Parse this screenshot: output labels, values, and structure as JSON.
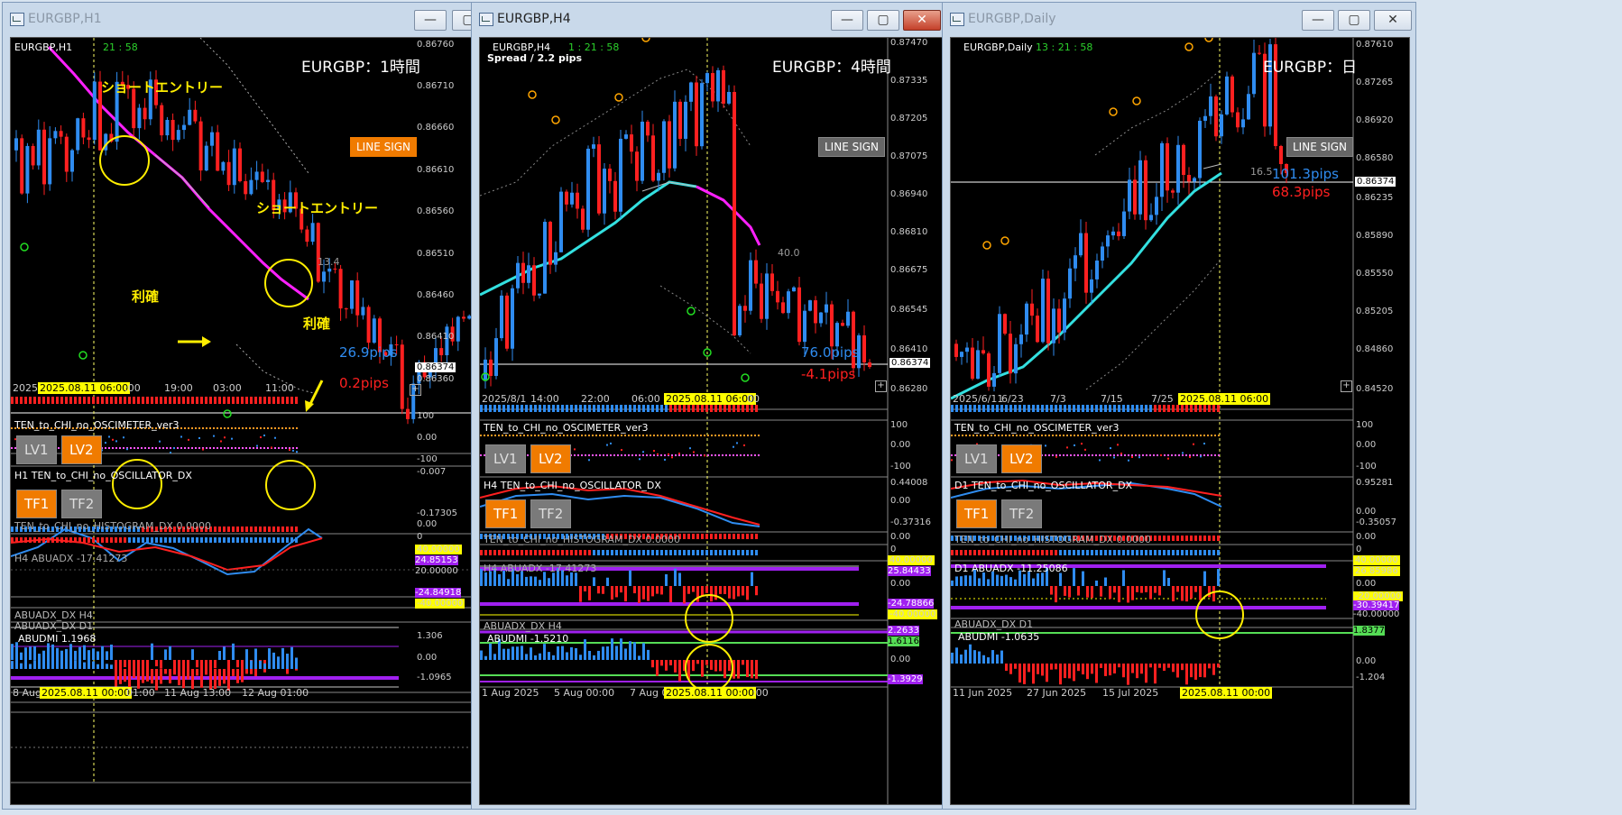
{
  "windows": [
    {
      "id": "h1",
      "title": "EURGBP,H1",
      "symbol": "EURGBP,H1",
      "timer": "21 : 58",
      "chart_title": "EURGBP：1時間",
      "spread": "",
      "line_sign": "LINE SIGN",
      "prices": [
        "0.86760",
        "0.86710",
        "0.86660",
        "0.86610",
        "0.86560",
        "0.86510",
        "0.86460",
        "0.86410",
        "0.86360"
      ],
      "current_price": "0.86374",
      "pips_up": "26.9pips",
      "pips_down": "0.2pips",
      "level_value": "13.4",
      "time_labels": [
        "2025/",
        "2025.08.11 06:00",
        ":00",
        "19:00",
        "03:00",
        "11:00"
      ],
      "bottom_time_labels": [
        "8 Aug",
        "2025.08.11 00:00",
        "01:00",
        "11 Aug 13:00",
        "12 Aug 01:00"
      ],
      "annotations": [
        "ショートエントリー",
        "ショートエントリー",
        "利確",
        "利確"
      ],
      "osc_title": "TEN_to_CHI_no_OSCIMETER_ver3",
      "osc_levels": [
        "100",
        "0.00",
        "-100"
      ],
      "lv1": "LV1",
      "lv2": "LV2",
      "dx_title": "H1 TEN_to_CHI_no_OSCILLATOR_DX",
      "dx_levels": [
        "-0.007",
        "-0.17305"
      ],
      "tf1": "TF1",
      "tf2": "TF2",
      "hist_title": "TEN_to_CHI_no_HISTOGRAM_DX 0.0000",
      "hist_levels": [
        "0.00",
        "0"
      ],
      "abuadx_title": "H4 ABUADX -17.41273",
      "abuadx_levels": [
        "40.00000",
        "24.85153",
        "20.00000",
        "-24.84918",
        "-40.00000"
      ],
      "abuadx_h4": "ABUADX_DX H4",
      "abuadx_d1": "ABUADX_DX D1",
      "abudmi_title": "ABUDMI  1.1968",
      "abudmi_levels": [
        "1.306",
        "0.00",
        "-1.0965"
      ],
      "sub_mark": "H1"
    },
    {
      "id": "h4",
      "title": "EURGBP,H4",
      "symbol": "EURGBP,H4",
      "timer": "1 : 21 : 58",
      "chart_title": "EURGBP：4時間",
      "spread": "Spread / 2.2 pips",
      "line_sign": "LINE SIGN",
      "prices": [
        "0.87470",
        "0.87335",
        "0.87205",
        "0.87075",
        "0.86940",
        "0.86810",
        "0.86675",
        "0.86545",
        "0.86410",
        "0.86280"
      ],
      "current_price": "0.86374",
      "pips_up": "76.0pips",
      "pips_down": "-4.1pips",
      "level_value": "40.0",
      "time_labels": [
        "2025/8/1",
        "14:00",
        "22:00",
        "06:00",
        "2025.08.11 06:00",
        "00"
      ],
      "bottom_time_labels": [
        "1 Aug 2025",
        "5 Aug 00:00",
        "7 Aug 0",
        "2025.08.11 00:00",
        ":00"
      ],
      "annotations": [],
      "osc_title": "TEN_to_CHI_no_OSCIMETER_ver3",
      "osc_levels": [
        "100",
        "0.00",
        "-100"
      ],
      "lv1": "LV1",
      "lv2": "LV2",
      "dx_title": "H4 TEN_to_CHI_no_OSCILLATOR_DX",
      "dx_levels": [
        "0.44008",
        "0.00",
        "-0.37316"
      ],
      "tf1": "TF1",
      "tf2": "TF2",
      "hist_title": "TEN_to_CHI_no_HISTOGRAM_DX 0.0000",
      "hist_levels": [
        "0.00",
        "0"
      ],
      "abuadx_title": "H4 ABUADX -17.41273",
      "abuadx_levels": [
        "40.00000",
        "25.84433",
        "0.00",
        "-24.78866",
        "-40.00000"
      ],
      "abuadx_h4": "ABUADX_DX H4",
      "abuadx_d1": "",
      "abudmi_title": "ABUDMI  -1.5210",
      "abudmi_levels": [
        "2.2633",
        "1.6116",
        "0.00",
        "-1.3929"
      ],
      "sub_mark": "H4"
    },
    {
      "id": "d1",
      "title": "EURGBP,Daily",
      "symbol": "EURGBP,Daily",
      "timer": "13 : 21 : 58",
      "chart_title": "EURGBP：日",
      "spread": "",
      "line_sign": "LINE SIGN",
      "prices": [
        "0.87610",
        "0.87265",
        "0.86920",
        "0.86580",
        "0.86235",
        "0.85890",
        "0.85550",
        "0.85205",
        "0.84860",
        "0.84520"
      ],
      "current_price": "0.86374",
      "pips_up": "101.3pips",
      "pips_down": "68.3pips",
      "level_value": "16.5",
      "time_labels": [
        "2025/6/11",
        "6/23",
        "7/3",
        "7/15",
        "7/25",
        "2025.08.11 06:00"
      ],
      "bottom_time_labels": [
        "11 Jun 2025",
        "27 Jun 2025",
        "15 Jul 2025",
        "2025.08.11 00:00"
      ],
      "annotations": [],
      "osc_title": "TEN_to_CHI_no_OSCIMETER_ver3",
      "osc_levels": [
        "100",
        "0.00",
        "-100"
      ],
      "lv1": "LV1",
      "lv2": "LV2",
      "dx_title": "D1 TEN_to_CHI_no_OSCILLATOR_DX",
      "dx_levels": [
        "0.95281",
        "0.00",
        "-0.35057"
      ],
      "tf1": "TF1",
      "tf2": "TF2",
      "hist_title": "TEN_to_CHI_no_HISTOGRAM_DX 0.0000",
      "hist_levels": [
        "0.00",
        "0"
      ],
      "abuadx_title": "D1 ABUADX -11.25086",
      "abuadx_levels": [
        "40.00000",
        "26.85986",
        "0.00",
        "-20.00000",
        "-30.39417",
        "-40.00000"
      ],
      "abuadx_h4": "ABUADX_DX D1",
      "abuadx_d1": "",
      "abudmi_title": "ABUDMI  -1.0635",
      "abudmi_levels": [
        "1.8377",
        "0.00",
        "-1.204"
      ],
      "sub_mark": "D1"
    }
  ],
  "window_buttons": {
    "minimize": "—",
    "maximize": "▢",
    "close": "✕"
  }
}
